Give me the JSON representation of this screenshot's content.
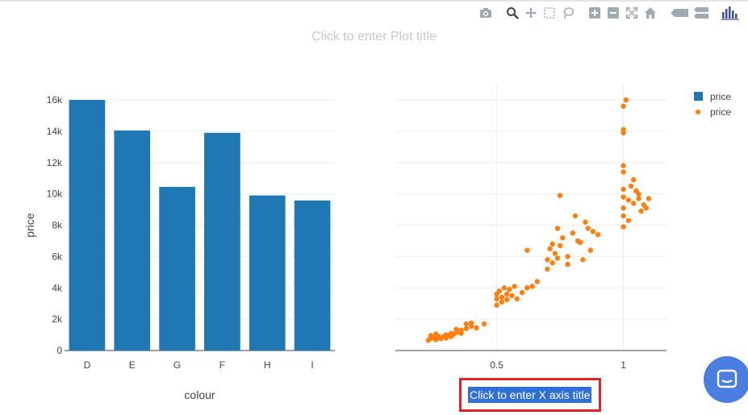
{
  "plot_title": "Click to enter Plot title",
  "colors": {
    "bar": "#1f77b4",
    "scatter": "#ff7f0e",
    "grid": "#eeeeee",
    "highlight": "#e0202a",
    "chat": "#4a7ee0"
  },
  "modebar": [
    "camera-icon",
    "zoom-icon",
    "pan-icon",
    "box-select-icon",
    "lasso-icon",
    "zoom-in-icon",
    "zoom-out-icon",
    "autoscale-icon",
    "reset-axes-icon",
    "spike-lines-icon",
    "compare-hover-icon",
    "plotly-logo-icon"
  ],
  "legend": [
    {
      "label": "price",
      "marker": "bar"
    },
    {
      "label": "price",
      "marker": "dot"
    }
  ],
  "x2_title": "Click to enter X axis title",
  "chart_data": [
    {
      "type": "bar",
      "categories": [
        "D",
        "E",
        "G",
        "F",
        "H",
        "I"
      ],
      "series": [
        {
          "name": "price",
          "values": [
            16000,
            14050,
            10450,
            13900,
            9900,
            9580
          ]
        }
      ],
      "ylabel": "price",
      "xlabel": "colour",
      "ylim": [
        0,
        16000
      ],
      "yticks": [
        "0",
        "2k",
        "4k",
        "6k",
        "8k",
        "10k",
        "12k",
        "14k",
        "16k"
      ],
      "grid": true
    },
    {
      "type": "scatter",
      "series": [
        {
          "name": "price",
          "points": [
            [
              0.23,
              650
            ],
            [
              0.24,
              780
            ],
            [
              0.25,
              820
            ],
            [
              0.26,
              700
            ],
            [
              0.27,
              900
            ],
            [
              0.28,
              760
            ],
            [
              0.29,
              880
            ],
            [
              0.3,
              1000
            ],
            [
              0.31,
              950
            ],
            [
              0.32,
              1100
            ],
            [
              0.33,
              1050
            ],
            [
              0.34,
              1150
            ],
            [
              0.35,
              1200
            ],
            [
              0.36,
              1300
            ],
            [
              0.38,
              1400
            ],
            [
              0.4,
              1550
            ],
            [
              0.42,
              1450
            ],
            [
              0.24,
              950
            ],
            [
              0.26,
              1050
            ],
            [
              0.3,
              800
            ],
            [
              0.32,
              900
            ],
            [
              0.34,
              1350
            ],
            [
              0.36,
              1100
            ],
            [
              0.38,
              1700
            ],
            [
              0.4,
              1750
            ],
            [
              0.45,
              1700
            ],
            [
              0.5,
              3600
            ],
            [
              0.5,
              3300
            ],
            [
              0.51,
              3800
            ],
            [
              0.52,
              3400
            ],
            [
              0.53,
              4000
            ],
            [
              0.54,
              3600
            ],
            [
              0.55,
              3900
            ],
            [
              0.56,
              3500
            ],
            [
              0.57,
              4100
            ],
            [
              0.6,
              3700
            ],
            [
              0.62,
              4000
            ],
            [
              0.64,
              4100
            ],
            [
              0.66,
              4400
            ],
            [
              0.5,
              2900
            ],
            [
              0.52,
              3100
            ],
            [
              0.54,
              3250
            ],
            [
              0.58,
              3300
            ],
            [
              0.62,
              6400
            ],
            [
              0.7,
              5800
            ],
            [
              0.7,
              5200
            ],
            [
              0.71,
              6500
            ],
            [
              0.72,
              5600
            ],
            [
              0.73,
              6200
            ],
            [
              0.74,
              5900
            ],
            [
              0.75,
              6700
            ],
            [
              0.76,
              7200
            ],
            [
              0.78,
              6000
            ],
            [
              0.8,
              7500
            ],
            [
              0.81,
              8600
            ],
            [
              0.82,
              7000
            ],
            [
              0.83,
              6900
            ],
            [
              0.85,
              8200
            ],
            [
              0.87,
              6400
            ],
            [
              0.88,
              7600
            ],
            [
              0.9,
              7400
            ],
            [
              0.75,
              9900
            ],
            [
              0.72,
              6800
            ],
            [
              0.74,
              7800
            ],
            [
              0.78,
              5500
            ],
            [
              0.84,
              5800
            ],
            [
              0.86,
              7800
            ],
            [
              1.0,
              7900
            ],
            [
              1.0,
              8600
            ],
            [
              1.0,
              9100
            ],
            [
              1.0,
              9800
            ],
            [
              1.0,
              10300
            ],
            [
              1.0,
              11400
            ],
            [
              1.0,
              11800
            ],
            [
              1.0,
              13900
            ],
            [
              1.0,
              14100
            ],
            [
              1.0,
              15600
            ],
            [
              1.01,
              16000
            ],
            [
              1.02,
              9600
            ],
            [
              1.03,
              10500
            ],
            [
              1.04,
              9400
            ],
            [
              1.05,
              10200
            ],
            [
              1.06,
              9700
            ],
            [
              1.07,
              8900
            ],
            [
              1.08,
              9300
            ],
            [
              1.1,
              9700
            ],
            [
              1.02,
              8300
            ],
            [
              1.04,
              10900
            ],
            [
              1.06,
              10000
            ],
            [
              1.09,
              9100
            ]
          ]
        }
      ],
      "xlim": [
        0.1,
        1.17
      ],
      "ylim": [
        0,
        16000
      ],
      "xticks": [
        0.5,
        1
      ],
      "xtick_labels": [
        "0.5",
        "1"
      ],
      "grid": true
    }
  ]
}
